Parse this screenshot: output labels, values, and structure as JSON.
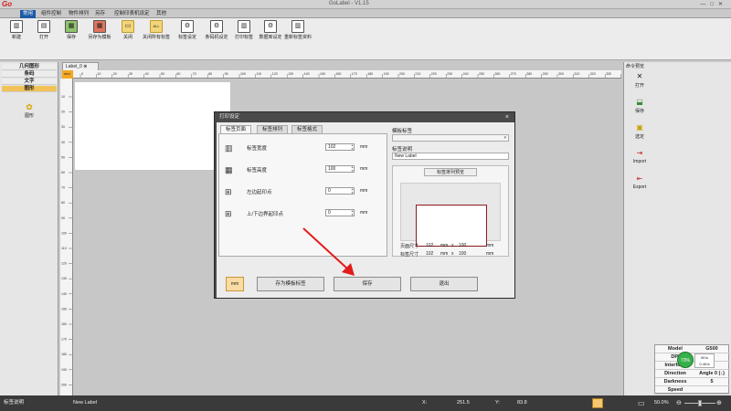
{
  "app": {
    "title": "GoLabel - V1.15",
    "logo": "Go"
  },
  "menu": {
    "tabs": [
      "常用",
      "组件控制",
      "物件排列",
      "另存",
      "控制印表机设定",
      "其他"
    ],
    "active": 0
  },
  "ribbon": {
    "buttons": [
      {
        "label": "新建",
        "icon": "new-icon"
      },
      {
        "label": "打开",
        "icon": "open-icon"
      },
      {
        "label": "保存",
        "icon": "save-icon"
      },
      {
        "label": "另存为模板",
        "icon": "save-template-icon"
      },
      {
        "label": "关闭",
        "icon": "close-icon"
      },
      {
        "label": "关闭所有标签",
        "icon": "close-all-icon"
      },
      {
        "label": "标签设定",
        "icon": "label-setup-icon"
      },
      {
        "label": "条码机设定",
        "icon": "printer-setup-icon"
      },
      {
        "label": "打印标签",
        "icon": "print-icon"
      },
      {
        "label": "数据库设定",
        "icon": "database-icon"
      },
      {
        "label": "重新标签资料",
        "icon": "refresh-icon"
      }
    ]
  },
  "left_panel": {
    "items": [
      "几何图形",
      "条码",
      "文字",
      "图形"
    ],
    "selected": 3,
    "tool": {
      "label": "图形",
      "icon": "image-icon"
    }
  },
  "document": {
    "tab": "Label_0"
  },
  "ruler": {
    "h_ticks": [
      "0",
      "10",
      "20",
      "30",
      "40",
      "50",
      "60",
      "70",
      "80",
      "90",
      "100",
      "110",
      "120",
      "130",
      "140",
      "150",
      "160",
      "170",
      "180",
      "190",
      "200",
      "210",
      "220",
      "230",
      "240",
      "250",
      "260",
      "270",
      "280",
      "290",
      "300",
      "310",
      "320",
      "330",
      "340"
    ],
    "v_ticks": [
      "10",
      "20",
      "30",
      "40",
      "50",
      "60",
      "70",
      "80",
      "90",
      "100",
      "110",
      "120",
      "130",
      "140",
      "150",
      "160",
      "170",
      "180",
      "190",
      "200",
      "210"
    ],
    "corner": "mm"
  },
  "right_panel": {
    "title": "命令预览",
    "buttons": [
      {
        "label": "打开",
        "icon": "open-folder-icon"
      },
      {
        "label": "保存",
        "icon": "save-icon"
      },
      {
        "label": "选定",
        "icon": "select-icon"
      },
      {
        "label": "Import",
        "icon": "import-icon"
      },
      {
        "label": "Export",
        "icon": "export-icon"
      }
    ]
  },
  "printer_info": {
    "rows": [
      {
        "key": "Model",
        "value": "G500"
      },
      {
        "key": "DPI",
        "value": ""
      },
      {
        "key": "Interface",
        "value": ""
      },
      {
        "key": "Direction",
        "value": "Angle 0 (↓)"
      },
      {
        "key": "Darkness",
        "value": "5"
      },
      {
        "key": "Speed",
        "value": ""
      }
    ],
    "badge": "73%",
    "stat1": "0K/s",
    "stat2": "0.4K/s"
  },
  "status": {
    "label": "标签说明",
    "value": "New Label",
    "x_label": "X:",
    "x_value": "251.5",
    "y_label": "Y:",
    "y_value": "83.8",
    "zoom": "50.0%",
    "zoom_level": 0.5
  },
  "dialog": {
    "title": "打印设定",
    "close": "×",
    "tabs": [
      "标签页面",
      "标签排列",
      "标签格式"
    ],
    "active_tab": 0,
    "fields": [
      {
        "label": "标签宽度",
        "value": "102",
        "unit": "mm",
        "icon": "label-width-icon"
      },
      {
        "label": "标签高度",
        "value": "100",
        "unit": "mm",
        "icon": "label-height-icon"
      },
      {
        "label": "左边起印点",
        "value": "0",
        "unit": "mm",
        "icon": "left-margin-icon"
      },
      {
        "label": "上/下边界起印点",
        "value": "0",
        "unit": "mm",
        "icon": "top-margin-icon"
      }
    ],
    "template_label": "模板标签",
    "template_value": "",
    "desc_label": "标签说明",
    "desc_value": "New Label",
    "preview_title": "标签排列预览",
    "page_size_label": "页面尺寸",
    "page_w": "102",
    "page_h": "100",
    "label_size_label": "标签尺寸",
    "label_w": "102",
    "label_h": "100",
    "unit_mm": "mm",
    "times": "x",
    "unit_button": "mm",
    "buttons": {
      "save_template": "存为模板标签",
      "save": "保存",
      "exit": "退出"
    }
  }
}
